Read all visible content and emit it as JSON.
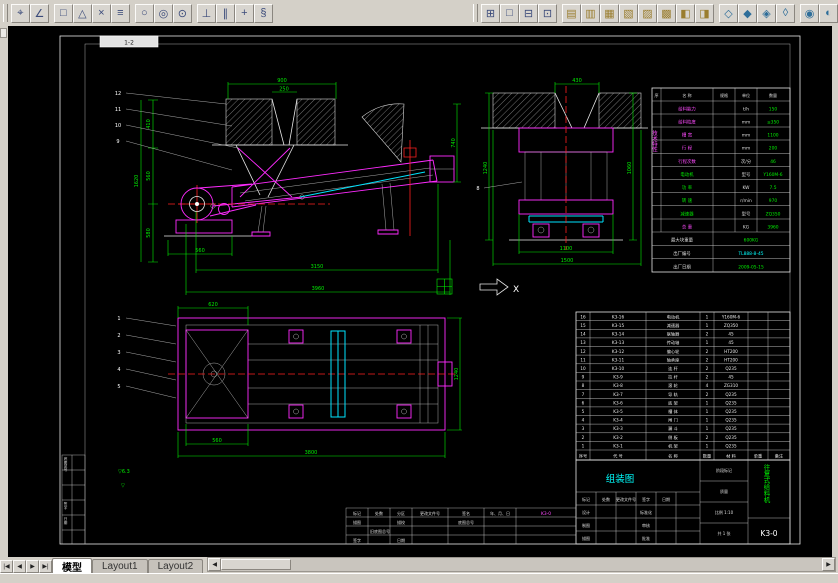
{
  "toolbar": {
    "left": [
      {
        "name": "osnap-track",
        "glyph": "⌖"
      },
      {
        "name": "osnap-from",
        "glyph": "∠"
      },
      {
        "name": "osnap-endpoint",
        "glyph": "□"
      },
      {
        "name": "osnap-midpoint",
        "glyph": "△"
      },
      {
        "name": "osnap-intersection",
        "glyph": "×"
      },
      {
        "name": "osnap-extension",
        "glyph": "≡"
      },
      {
        "name": "osnap-center",
        "glyph": "○"
      },
      {
        "name": "osnap-quadrant",
        "glyph": "◎"
      },
      {
        "name": "osnap-tangent",
        "glyph": "⊙"
      },
      {
        "name": "osnap-perpendicular",
        "glyph": "⊥"
      },
      {
        "name": "osnap-parallel",
        "glyph": "∥"
      },
      {
        "name": "osnap-node",
        "glyph": "+"
      },
      {
        "name": "osnap-settings",
        "glyph": "§"
      }
    ],
    "right": [
      {
        "name": "named-views",
        "glyph": "⊞"
      },
      {
        "name": "plot-preview",
        "glyph": "□"
      },
      {
        "name": "paper-space",
        "glyph": "⊟"
      },
      {
        "name": "page-setup",
        "glyph": "⊡"
      },
      {
        "name": "top-view",
        "glyph": "▤"
      },
      {
        "name": "bottom-view",
        "glyph": "▥"
      },
      {
        "name": "left-view",
        "glyph": "▦"
      },
      {
        "name": "right-view",
        "glyph": "▧"
      },
      {
        "name": "front-view",
        "glyph": "▨"
      },
      {
        "name": "back-view",
        "glyph": "▩"
      },
      {
        "name": "view-previous",
        "glyph": "◧"
      },
      {
        "name": "view-next",
        "glyph": "◨"
      },
      {
        "name": "sw-isometric",
        "glyph": "◇"
      },
      {
        "name": "se-isometric",
        "glyph": "◆"
      },
      {
        "name": "ne-isometric",
        "glyph": "◈"
      },
      {
        "name": "nw-isometric",
        "glyph": "◊"
      },
      {
        "name": "camera",
        "glyph": "◉"
      },
      {
        "name": "orbit",
        "glyph": "◐"
      }
    ]
  },
  "sheet": {
    "zone_label": "1-2",
    "axis_label": "X",
    "roughness_note": "▽6.3",
    "roughness_note2": "▽"
  },
  "dims": {
    "side_top": "900",
    "side_top2": "250",
    "side_left1": "410",
    "side_left2": "560",
    "side_left3": "580",
    "side_left_total": "1620",
    "side_right": "740",
    "side_drive": "560",
    "side_bottom1": "3150",
    "side_bottom2": "3960",
    "end_top": "430",
    "end_left": "1240",
    "end_right": "1060",
    "end_bottom1": "1100",
    "end_bottom2": "1500",
    "plan_top": "620",
    "plan_right": "1240",
    "plan_bottom1": "560",
    "plan_bottom2": "3800"
  },
  "balloons": {
    "side": [
      "12",
      "11",
      "10",
      "9"
    ],
    "plan": [
      "1",
      "2",
      "3",
      "4",
      "5"
    ],
    "end": "8"
  },
  "spec_table": {
    "vertical_title": "技术特性",
    "header": [
      "序",
      "名  称",
      "规格",
      "单位",
      "数量"
    ],
    "rows": [
      [
        "给料能力",
        "t/h",
        "150"
      ],
      [
        "给料粒度",
        "mm",
        "≤350"
      ],
      [
        "槽  宽",
        "mm",
        "1100"
      ],
      [
        "行  程",
        "mm",
        "200"
      ],
      [
        "行程次数",
        "次/分",
        "46"
      ],
      [
        "电动机",
        "型号",
        "Y160M-6"
      ],
      [
        "功  率",
        "KW",
        "7.5"
      ],
      [
        "转  速",
        "r/min",
        "970"
      ],
      [
        "减速器",
        "型号",
        "ZQ350"
      ],
      [
        "总  重",
        "KG",
        "3960"
      ]
    ],
    "notes": [
      [
        "最大块重量",
        "600KG"
      ],
      [
        "出厂编号",
        "TL888-8-45"
      ],
      [
        "出厂日期",
        "2009-05-15"
      ]
    ]
  },
  "bom": {
    "header": [
      "序号",
      "代  号",
      "名  称",
      "数量",
      "材  料",
      "单重",
      "备注"
    ],
    "rows": [
      [
        "16",
        "K3-16",
        "电动机",
        "1",
        "Y160M-6"
      ],
      [
        "15",
        "K3-15",
        "减速器",
        "1",
        "ZQ350"
      ],
      [
        "14",
        "K3-14",
        "联轴器",
        "2",
        "45"
      ],
      [
        "13",
        "K3-13",
        "传动轴",
        "1",
        "45"
      ],
      [
        "12",
        "K3-12",
        "偏心轮",
        "2",
        "HT200"
      ],
      [
        "11",
        "K3-11",
        "轴承座",
        "2",
        "HT200"
      ],
      [
        "10",
        "K3-10",
        "连  杆",
        "2",
        "Q235"
      ],
      [
        "9",
        "K3-9",
        "拉  杆",
        "2",
        "45"
      ],
      [
        "8",
        "K3-8",
        "滚  轮",
        "4",
        "ZG310"
      ],
      [
        "7",
        "K3-7",
        "导  轨",
        "2",
        "Q235"
      ],
      [
        "6",
        "K3-6",
        "底  架",
        "1",
        "Q235"
      ],
      [
        "5",
        "K3-5",
        "槽  体",
        "1",
        "Q235"
      ],
      [
        "4",
        "K3-4",
        "闸  门",
        "1",
        "Q235"
      ],
      [
        "3",
        "K3-3",
        "漏  斗",
        "1",
        "Q235"
      ],
      [
        "2",
        "K3-2",
        "侧  板",
        "2",
        "Q235"
      ],
      [
        "1",
        "K3-1",
        "机  架",
        "1",
        "Q235"
      ]
    ]
  },
  "title_block": {
    "drawing_type": "组装图",
    "product": "往复式给料机",
    "number": "K3-0",
    "rev_header": [
      "标记",
      "处数",
      "更改文件号",
      "签字",
      "日期"
    ],
    "sign_rows": [
      [
        "设计",
        "标准化"
      ],
      [
        "制图",
        "审核"
      ],
      [
        "描图",
        "批准"
      ]
    ],
    "stage_label": "阶段标记",
    "mass_label": "质量",
    "scale_label": "比例 1:10",
    "sheet_label": "共 1 张"
  },
  "revision_table": {
    "header": [
      "标记",
      "处数",
      "分区",
      "更改文件号",
      "签名",
      "年、月、日"
    ],
    "mark": "K3-0",
    "row2": [
      "描图",
      "描校",
      "底图总号"
    ],
    "row3": "旧底图总号",
    "row4": [
      "签字",
      "日期"
    ]
  },
  "margin_labels": [
    "底图总号",
    "签字",
    "日期"
  ],
  "tabs": {
    "nav": [
      "|◀",
      "◀",
      "▶",
      "▶|"
    ],
    "scroll_left": "◀",
    "scroll_right": "▶",
    "items": [
      {
        "label": "模型"
      },
      {
        "label": "Layout1"
      },
      {
        "label": "Layout2"
      }
    ]
  }
}
